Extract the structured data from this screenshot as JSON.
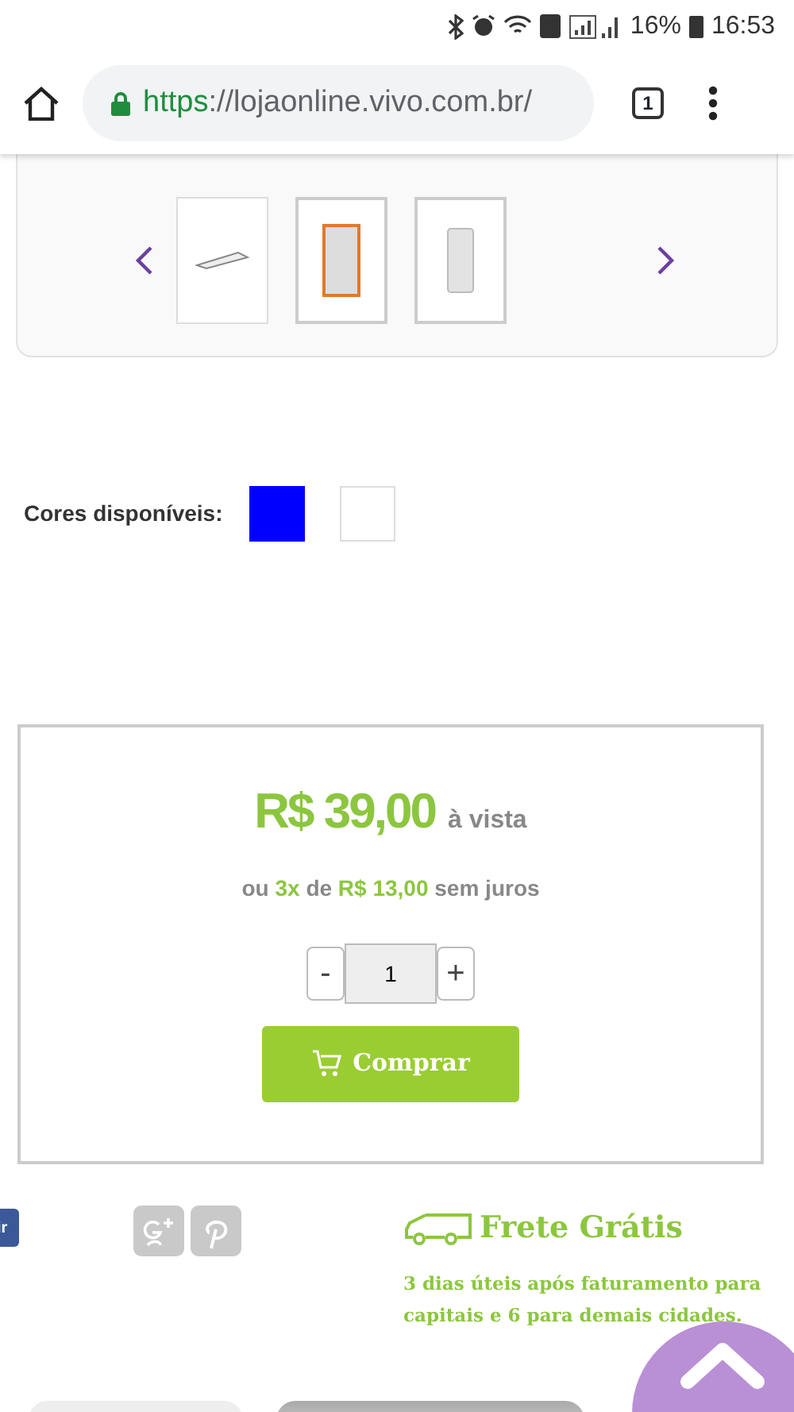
{
  "status_bar": {
    "battery": "16%",
    "time": "16:53"
  },
  "browser": {
    "url_scheme": "https",
    "url_rest": "://lojaonline.vivo.com.br/",
    "tab_count": "1"
  },
  "gallery": {
    "thumbnails": [
      {
        "selected": false
      },
      {
        "selected": true
      },
      {
        "selected": true
      }
    ]
  },
  "colors": {
    "label": "Cores disponíveis:",
    "swatches": [
      {
        "color": "#0000ff"
      },
      {
        "color": "#ffffff"
      }
    ]
  },
  "price": {
    "amount": "R$ 39,00",
    "suffix": "à vista",
    "installments": {
      "prefix": "ou",
      "count": "3x",
      "joiner": "de",
      "value": "R$ 13,00",
      "suffix": "sem juros"
    },
    "minus": "-",
    "quantity": "1",
    "plus": "+",
    "buy": "Comprar"
  },
  "share": {
    "facebook_label": "ir"
  },
  "shipping": {
    "title": "Frete Grátis",
    "note": "3 dias úteis após faturamento para capitais e 6 para demais cidades."
  }
}
